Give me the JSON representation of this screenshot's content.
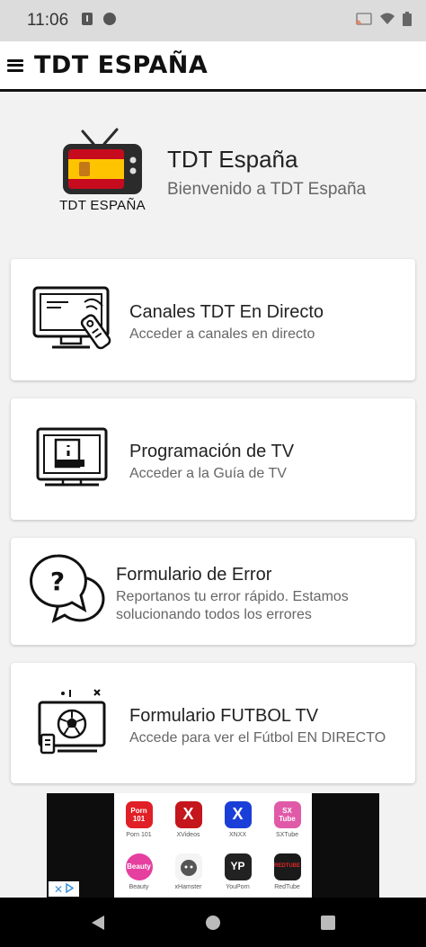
{
  "status_bar": {
    "time": "11:06"
  },
  "app_bar": {
    "title": "TDT ESPAÑA"
  },
  "header": {
    "logo_caption": "TDT ESPAÑA",
    "title": "TDT España",
    "subtitle": "Bienvenido a TDT España"
  },
  "cards": [
    {
      "title": "Canales TDT En Directo",
      "subtitle": "Acceder a canales en directo",
      "icon": "tv-remote-icon"
    },
    {
      "title": "Programación de TV",
      "subtitle": "Acceder a la Guía de TV",
      "icon": "tv-guide-icon"
    },
    {
      "title": "Formulario de Error",
      "subtitle_line1": "Reportanos tu error rápido. Estamos",
      "subtitle_line2": "solucionando todos los errores",
      "icon": "question-chat-icon"
    },
    {
      "title": "Formulario FUTBOL TV",
      "subtitle": "Accede para ver el Fútbol EN DIRECTO",
      "icon": "football-tv-icon"
    }
  ],
  "ad": {
    "apps": [
      {
        "tile": "Porn 101",
        "label": "Porn 101",
        "color": "#e01f26"
      },
      {
        "tile": "X",
        "label": "XVideos",
        "color": "#c4161c"
      },
      {
        "tile": "X",
        "label": "XNXX",
        "color": "#1a3fd8"
      },
      {
        "tile": "SX Tube",
        "label": "SXTube",
        "color": "#e05aa8"
      },
      {
        "tile": "Beauty",
        "label": "Beauty",
        "color": "#e53fa0"
      },
      {
        "tile": "",
        "label": "xHamster",
        "color": "#f4f4f4"
      },
      {
        "tile": "YP",
        "label": "YouPorn",
        "color": "#222222"
      },
      {
        "tile": "REDTUBE",
        "label": "RedTube",
        "color": "#1a1a1a"
      }
    ]
  },
  "colors": {
    "flag_red": "#c60b1e",
    "flag_yellow": "#ffc400",
    "tv_dark": "#2b2b2b",
    "status_bar": "#dcdcdc",
    "nav_bar": "#000000"
  }
}
